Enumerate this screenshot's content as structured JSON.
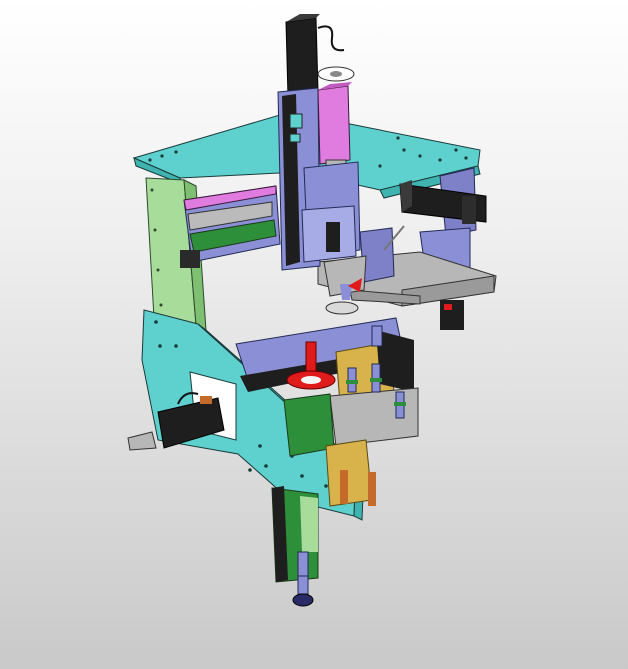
{
  "scene": {
    "kind": "3d-cad-assembly-view",
    "background": {
      "top": "#ffffff",
      "bottom": "#c9c9c9"
    },
    "colors": {
      "frame_cyan": "#5ed1cf",
      "frame_green": "#a8dc9a",
      "actuator_purple": "#8b8fd6",
      "accent_magenta": "#e07be0",
      "motor_black": "#1e1e1e",
      "plate_gray": "#b7b7b7",
      "highlight_red": "#e01b1b",
      "brass": "#d8b24a"
    },
    "parts": [
      "top-frame-plate",
      "left-column",
      "right-column",
      "vertical-servo-motor",
      "magenta-cylinder",
      "horizontal-linear-module",
      "right-servo-motor",
      "gray-slide-rail",
      "purple-bracket",
      "lower-frame-plate",
      "lower-servo-motor",
      "red-spindle",
      "indexing-fixture",
      "bottom-lift-module",
      "bottom-knob"
    ]
  }
}
